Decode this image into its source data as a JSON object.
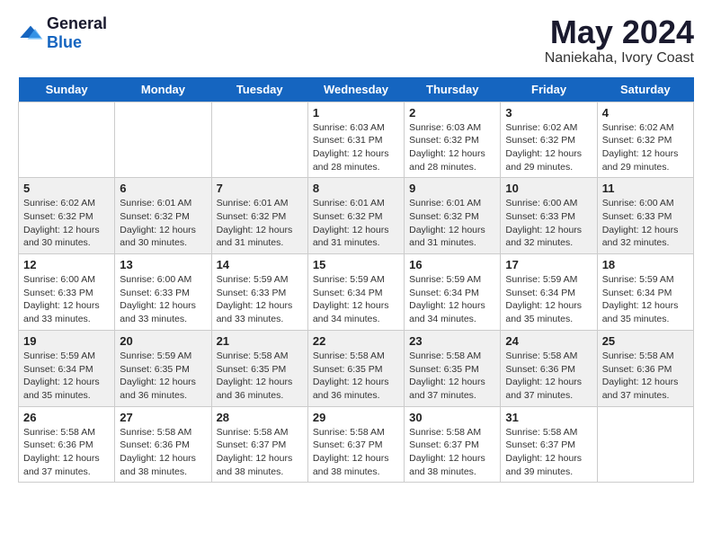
{
  "header": {
    "logo_general": "General",
    "logo_blue": "Blue",
    "title": "May 2024",
    "location": "Naniekaha, Ivory Coast"
  },
  "days_of_week": [
    "Sunday",
    "Monday",
    "Tuesday",
    "Wednesday",
    "Thursday",
    "Friday",
    "Saturday"
  ],
  "weeks": [
    [
      {
        "num": "",
        "info": ""
      },
      {
        "num": "",
        "info": ""
      },
      {
        "num": "",
        "info": ""
      },
      {
        "num": "1",
        "info": "Sunrise: 6:03 AM\nSunset: 6:31 PM\nDaylight: 12 hours\nand 28 minutes."
      },
      {
        "num": "2",
        "info": "Sunrise: 6:03 AM\nSunset: 6:32 PM\nDaylight: 12 hours\nand 28 minutes."
      },
      {
        "num": "3",
        "info": "Sunrise: 6:02 AM\nSunset: 6:32 PM\nDaylight: 12 hours\nand 29 minutes."
      },
      {
        "num": "4",
        "info": "Sunrise: 6:02 AM\nSunset: 6:32 PM\nDaylight: 12 hours\nand 29 minutes."
      }
    ],
    [
      {
        "num": "5",
        "info": "Sunrise: 6:02 AM\nSunset: 6:32 PM\nDaylight: 12 hours\nand 30 minutes."
      },
      {
        "num": "6",
        "info": "Sunrise: 6:01 AM\nSunset: 6:32 PM\nDaylight: 12 hours\nand 30 minutes."
      },
      {
        "num": "7",
        "info": "Sunrise: 6:01 AM\nSunset: 6:32 PM\nDaylight: 12 hours\nand 31 minutes."
      },
      {
        "num": "8",
        "info": "Sunrise: 6:01 AM\nSunset: 6:32 PM\nDaylight: 12 hours\nand 31 minutes."
      },
      {
        "num": "9",
        "info": "Sunrise: 6:01 AM\nSunset: 6:32 PM\nDaylight: 12 hours\nand 31 minutes."
      },
      {
        "num": "10",
        "info": "Sunrise: 6:00 AM\nSunset: 6:33 PM\nDaylight: 12 hours\nand 32 minutes."
      },
      {
        "num": "11",
        "info": "Sunrise: 6:00 AM\nSunset: 6:33 PM\nDaylight: 12 hours\nand 32 minutes."
      }
    ],
    [
      {
        "num": "12",
        "info": "Sunrise: 6:00 AM\nSunset: 6:33 PM\nDaylight: 12 hours\nand 33 minutes."
      },
      {
        "num": "13",
        "info": "Sunrise: 6:00 AM\nSunset: 6:33 PM\nDaylight: 12 hours\nand 33 minutes."
      },
      {
        "num": "14",
        "info": "Sunrise: 5:59 AM\nSunset: 6:33 PM\nDaylight: 12 hours\nand 33 minutes."
      },
      {
        "num": "15",
        "info": "Sunrise: 5:59 AM\nSunset: 6:34 PM\nDaylight: 12 hours\nand 34 minutes."
      },
      {
        "num": "16",
        "info": "Sunrise: 5:59 AM\nSunset: 6:34 PM\nDaylight: 12 hours\nand 34 minutes."
      },
      {
        "num": "17",
        "info": "Sunrise: 5:59 AM\nSunset: 6:34 PM\nDaylight: 12 hours\nand 35 minutes."
      },
      {
        "num": "18",
        "info": "Sunrise: 5:59 AM\nSunset: 6:34 PM\nDaylight: 12 hours\nand 35 minutes."
      }
    ],
    [
      {
        "num": "19",
        "info": "Sunrise: 5:59 AM\nSunset: 6:34 PM\nDaylight: 12 hours\nand 35 minutes."
      },
      {
        "num": "20",
        "info": "Sunrise: 5:59 AM\nSunset: 6:35 PM\nDaylight: 12 hours\nand 36 minutes."
      },
      {
        "num": "21",
        "info": "Sunrise: 5:58 AM\nSunset: 6:35 PM\nDaylight: 12 hours\nand 36 minutes."
      },
      {
        "num": "22",
        "info": "Sunrise: 5:58 AM\nSunset: 6:35 PM\nDaylight: 12 hours\nand 36 minutes."
      },
      {
        "num": "23",
        "info": "Sunrise: 5:58 AM\nSunset: 6:35 PM\nDaylight: 12 hours\nand 37 minutes."
      },
      {
        "num": "24",
        "info": "Sunrise: 5:58 AM\nSunset: 6:36 PM\nDaylight: 12 hours\nand 37 minutes."
      },
      {
        "num": "25",
        "info": "Sunrise: 5:58 AM\nSunset: 6:36 PM\nDaylight: 12 hours\nand 37 minutes."
      }
    ],
    [
      {
        "num": "26",
        "info": "Sunrise: 5:58 AM\nSunset: 6:36 PM\nDaylight: 12 hours\nand 37 minutes."
      },
      {
        "num": "27",
        "info": "Sunrise: 5:58 AM\nSunset: 6:36 PM\nDaylight: 12 hours\nand 38 minutes."
      },
      {
        "num": "28",
        "info": "Sunrise: 5:58 AM\nSunset: 6:37 PM\nDaylight: 12 hours\nand 38 minutes."
      },
      {
        "num": "29",
        "info": "Sunrise: 5:58 AM\nSunset: 6:37 PM\nDaylight: 12 hours\nand 38 minutes."
      },
      {
        "num": "30",
        "info": "Sunrise: 5:58 AM\nSunset: 6:37 PM\nDaylight: 12 hours\nand 38 minutes."
      },
      {
        "num": "31",
        "info": "Sunrise: 5:58 AM\nSunset: 6:37 PM\nDaylight: 12 hours\nand 39 minutes."
      },
      {
        "num": "",
        "info": ""
      }
    ]
  ]
}
